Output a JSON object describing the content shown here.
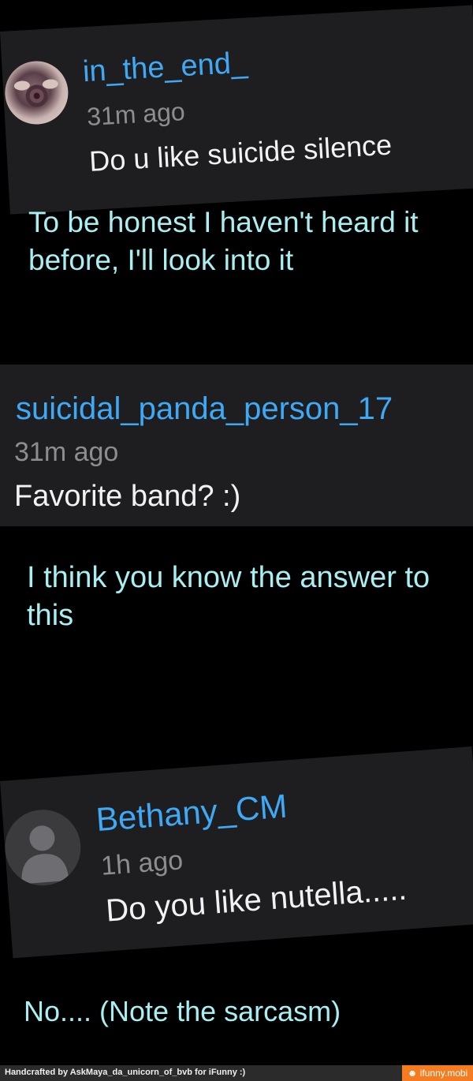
{
  "comments": [
    {
      "username": "in_the_end_",
      "time": "31m ago",
      "message": "Do u like suicide silence",
      "avatar": "rose-photo-avatar"
    },
    {
      "username": "suicidal_panda_person_17",
      "time": "31m ago",
      "message": "Favorite band? :)"
    },
    {
      "username": "Bethany_CM",
      "time": "1h ago",
      "message": "Do you like nutella.....",
      "avatar": "default-user-avatar"
    }
  ],
  "replies": [
    "To be honest I haven't heard it before, I'll look into it",
    "I think you know the answer to this",
    "No.... (Note the sarcasm)"
  ],
  "footer": {
    "credit": "Handcrafted by AskMaya_da_unicorn_of_bvb for iFunny :)",
    "brand": "☻ ifunny.mobi"
  },
  "colors": {
    "username": "#3fa9f5",
    "reply_text": "#a9eef0",
    "card_bg": "#1e1e20",
    "brand_orange": "#f57c20"
  }
}
